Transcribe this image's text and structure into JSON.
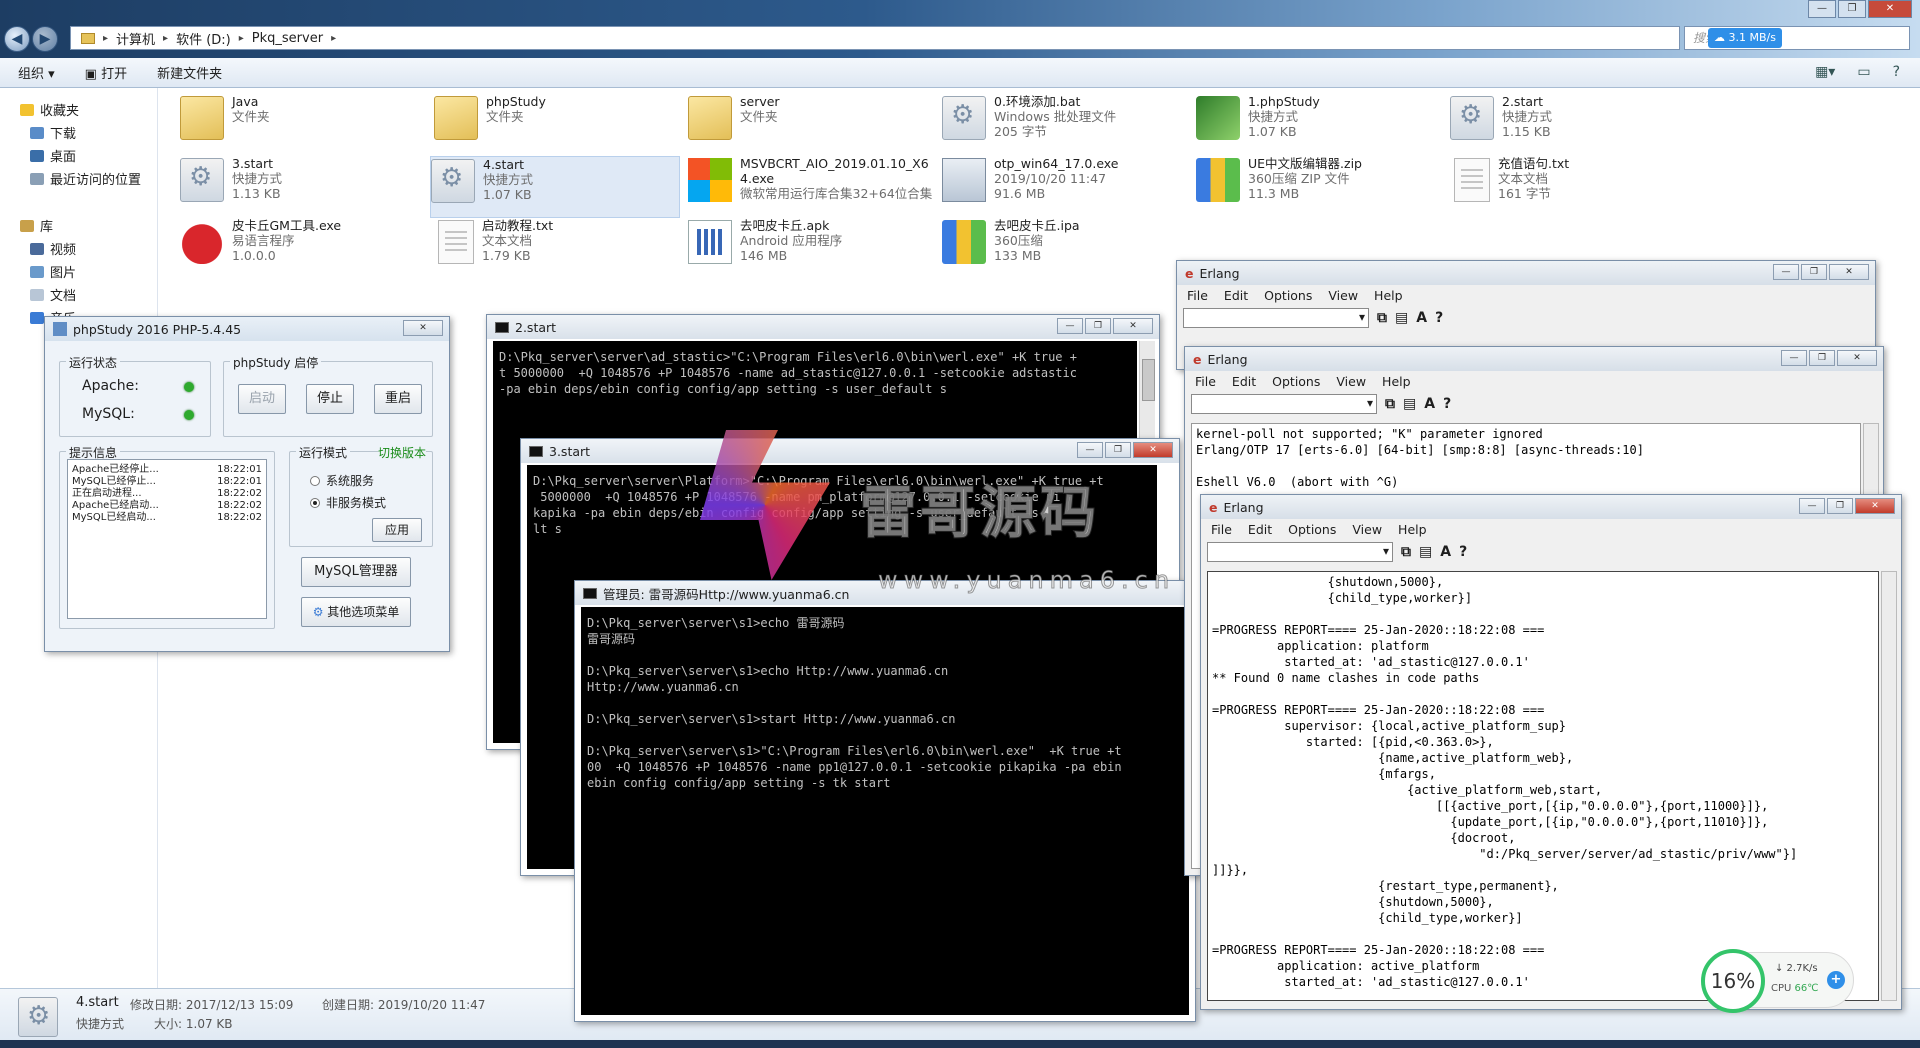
{
  "explorer": {
    "breadcrumb": [
      "计算机",
      "软件 (D:)",
      "Pkq_server"
    ],
    "search_placeholder": "搜索",
    "net_speed": "3.1 MB/s",
    "toolbar": {
      "organize": "组织 ▾",
      "open": "打开",
      "new_folder": "新建文件夹"
    },
    "nav": {
      "favorites": "收藏夹",
      "downloads": "下载",
      "desktop": "桌面",
      "recent": "最近访问的位置",
      "libraries": "库",
      "videos": "视频",
      "pictures": "图片",
      "documents": "文档",
      "music": "音乐"
    },
    "files": [
      {
        "name": "Java",
        "meta1": "文件夹",
        "meta2": "",
        "icon": "folder-icon"
      },
      {
        "name": "phpStudy",
        "meta1": "文件夹",
        "meta2": "",
        "icon": "folder-icon"
      },
      {
        "name": "server",
        "meta1": "文件夹",
        "meta2": "",
        "icon": "folder-icon"
      },
      {
        "name": "0.环境添加.bat",
        "meta1": "Windows 批处理文件",
        "meta2": "205 字节",
        "icon": "batch-file-icon"
      },
      {
        "name": "1.phpStudy",
        "meta1": "快捷方式",
        "meta2": "1.07 KB",
        "icon": "phpstudy-shortcut-icon"
      },
      {
        "name": "2.start",
        "meta1": "快捷方式",
        "meta2": "1.15 KB",
        "icon": "shortcut-icon"
      },
      {
        "name": "3.start",
        "meta1": "快捷方式",
        "meta2": "1.13 KB",
        "icon": "shortcut-icon"
      },
      {
        "name": "4.start",
        "meta1": "快捷方式",
        "meta2": "1.07 KB",
        "icon": "shortcut-icon"
      },
      {
        "name": "MSVBCRT_AIO_2019.01.10_X64.exe",
        "meta1": "微软常用运行库合集32+64位合集",
        "meta2": "",
        "icon": "microsoft-installer-icon"
      },
      {
        "name": "otp_win64_17.0.exe",
        "meta1": "2019/10/20 11:47",
        "meta2": "91.6 MB",
        "icon": "installer-icon"
      },
      {
        "name": "UE中文版编辑器.zip",
        "meta1": "360压缩 ZIP 文件",
        "meta2": "11.3 MB",
        "icon": "zip-icon"
      },
      {
        "name": "充值语句.txt",
        "meta1": "文本文档",
        "meta2": "161 字节",
        "icon": "text-file-icon"
      },
      {
        "name": "皮卡丘GM工具.exe",
        "meta1": "易语言程序",
        "meta2": "1.0.0.0",
        "icon": "angry-bird-icon"
      },
      {
        "name": "启动教程.txt",
        "meta1": "文本文档",
        "meta2": "1.79 KB",
        "icon": "text-file-icon"
      },
      {
        "name": "去吧皮卡丘.apk",
        "meta1": "Android 应用程序",
        "meta2": "146 MB",
        "icon": "apk-icon"
      },
      {
        "name": "去吧皮卡丘.ipa",
        "meta1": "360压缩",
        "meta2": "133 MB",
        "icon": "zip-icon"
      }
    ],
    "details": {
      "name": "4.start",
      "type": "快捷方式",
      "modified_label": "修改日期:",
      "modified": "2017/12/13 15:09",
      "created_label": "创建日期:",
      "created": "2019/10/20 11:47",
      "size_label": "大小:",
      "size": "1.07 KB"
    }
  },
  "phpstudy": {
    "title": "phpStudy 2016   PHP-5.4.45",
    "status_group": "运行状态",
    "apache_label": "Apache:",
    "mysql_label": "MySQL:",
    "control_group": "phpStudy 启停",
    "start": "启动",
    "stop": "停止",
    "restart": "重启",
    "info_group": "提示信息",
    "log": [
      {
        "msg": "Apache已经停止...",
        "time": "18:22:01"
      },
      {
        "msg": "MySQL已经停止...",
        "time": "18:22:01"
      },
      {
        "msg": "正在启动进程...",
        "time": "18:22:02"
      },
      {
        "msg": "Apache已经启动...",
        "time": "18:22:02"
      },
      {
        "msg": "MySQL已经启动...",
        "time": "18:22:02"
      }
    ],
    "mode_group": "运行模式",
    "switch_version": "切换版本",
    "system_service": "系统服务",
    "non_service": "非服务模式",
    "apply": "应用",
    "mysql_manager": "MySQL管理器",
    "other_menu": "其他选项菜单",
    "status_color": "#2eaa2e"
  },
  "console_2start": {
    "title": "2.start",
    "text": "D:\\Pkq_server\\server\\ad_stastic>\"C:\\Program Files\\erl6.0\\bin\\werl.exe\" +K true +\nt 5000000  +Q 1048576 +P 1048576 -name ad_stastic@127.0.0.1 -setcookie adstastic\n-pa ebin deps/ebin config config/app setting -s user_default s"
  },
  "console_3start": {
    "title": "3.start",
    "text": "D:\\Pkq_server\\server\\Platform>\"C:\\Program Files\\erl6.0\\bin\\werl.exe\" +K true +t\n 5000000  +Q 1048576 +P 1048576 -name pm_platform@127.0.0.1 -setcookie pi\nkapika -pa ebin deps/ebin config config/app setting -s user_default -s\nlt s"
  },
  "console_admin": {
    "title": "管理员: 雷哥源码Http://www.yuanma6.cn",
    "text": "D:\\Pkq_server\\server\\s1>echo 雷哥源码\n雷哥源码\n\nD:\\Pkq_server\\server\\s1>echo Http://www.yuanma6.cn\nHttp://www.yuanma6.cn\n\nD:\\Pkq_server\\server\\s1>start Http://www.yuanma6.cn\n\nD:\\Pkq_server\\server\\s1>\"C:\\Program Files\\erl6.0\\bin\\werl.exe\"  +K true +t\n00  +Q 1048576 +P 1048576 -name pp1@127.0.0.1 -setcookie pikapika -pa ebin\nebin config config/app setting -s tk start"
  },
  "erlang": {
    "title": "Erlang",
    "menu": [
      "File",
      "Edit",
      "Options",
      "View",
      "Help"
    ],
    "out2": "kernel-poll not supported; \"K\" parameter ignored\nErlang/OTP 17 [erts-6.0] [64-bit] [smp:8:8] [async-threads:10]\n\nEshell V6.0  (abort with ^G)",
    "out3": "                {shutdown,5000},\n                {child_type,worker}]\n\n=PROGRESS REPORT==== 25-Jan-2020::18:22:08 ===\n         application: platform\n          started_at: 'ad_stastic@127.0.0.1'\n** Found 0 name clashes in code paths\n\n=PROGRESS REPORT==== 25-Jan-2020::18:22:08 ===\n          supervisor: {local,active_platform_sup}\n             started: [{pid,<0.363.0>},\n                       {name,active_platform_web},\n                       {mfargs,\n                           {active_platform_web,start,\n                               [[{active_port,[{ip,\"0.0.0.0\"},{port,11000}]},\n                                 {update_port,[{ip,\"0.0.0.0\"},{port,11010}]},\n                                 {docroot,\n                                     \"d:/Pkq_server/server/ad_stastic/priv/www\"}]\n]]}},\n                       {restart_type,permanent},\n                       {shutdown,5000},\n                       {child_type,worker}]\n\n=PROGRESS REPORT==== 25-Jan-2020::18:22:08 ===\n         application: active_platform\n          started_at: 'ad_stastic@127.0.0.1'"
  },
  "watermark": {
    "title": "雷哥源码",
    "url": "www.yuanma6.cn"
  },
  "cpu_widget": {
    "percent": "16%",
    "net": "↓ 2.7K/s",
    "cpu_label": "CPU",
    "temp": "66℃",
    "accent": "#34c46a"
  }
}
